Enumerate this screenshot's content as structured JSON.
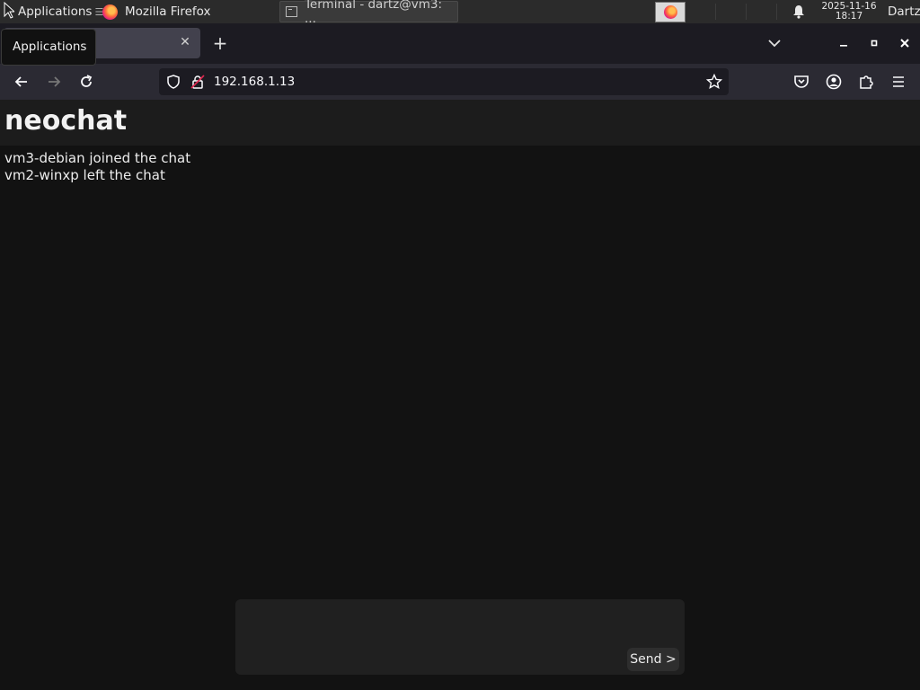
{
  "panel": {
    "applications_label": "Applications",
    "tasks": [
      {
        "label": "Mozilla Firefox"
      },
      {
        "label": "Terminal - dartz@vm3: ..."
      }
    ],
    "clock_date": "2025-11-16",
    "clock_time": "18:17",
    "user": "Dartz"
  },
  "browser": {
    "tab_tooltip": "Applications",
    "url": "192.168.1.13"
  },
  "page": {
    "title": "neochat",
    "messages": [
      "vm3-debian joined the chat",
      "vm2-winxp left the chat"
    ],
    "send_label": "Send >"
  },
  "colors": {
    "panel_bg": "#2b2b2b",
    "tabbar_bg": "#1c1b22",
    "navbar_bg": "#2b2a33",
    "page_bg": "#121212"
  }
}
